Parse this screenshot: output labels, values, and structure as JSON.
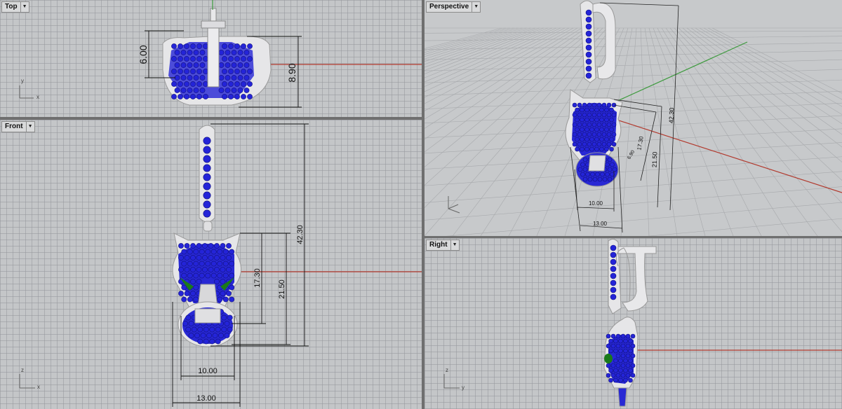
{
  "viewports": {
    "top": {
      "label": "Top",
      "axes": {
        "vertical": "y",
        "horizontal": "x"
      },
      "dims": {
        "d1": "6.00",
        "d2": "8.90"
      }
    },
    "front": {
      "label": "Front",
      "axes": {
        "vertical": "z",
        "horizontal": "x"
      },
      "dims": {
        "height_total": "42.30",
        "height_head": "17.30",
        "height_pendant": "21.50",
        "width_inner": "10.00",
        "width_outer": "13.00"
      }
    },
    "perspective": {
      "label": "Perspective",
      "dims": {
        "height_total": "42.30",
        "height_pendant": "21.50",
        "height_head": "17.30",
        "depth": "6.90",
        "width_inner": "10.00",
        "width_outer": "13.00"
      }
    },
    "right": {
      "label": "Right",
      "axes": {
        "vertical": "z",
        "horizontal": "y"
      }
    }
  },
  "colors": {
    "viewport_bg": "#c4c6c8",
    "grid": "#9a9ca0",
    "x_axis": "#b23a2e",
    "y_axis": "#3c9a3c",
    "metal": "#e4e4e6",
    "gem_blue": "#2424d8",
    "gem_green": "#1a7a1a"
  },
  "icons": {
    "dropdown": "chevron-down-icon"
  }
}
